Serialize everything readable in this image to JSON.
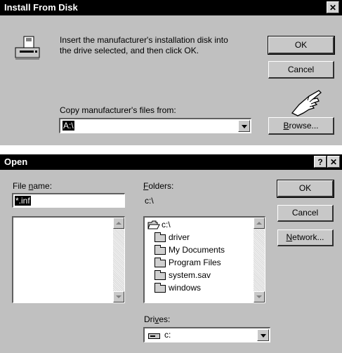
{
  "install_dialog": {
    "title": "Install From Disk",
    "close_glyph": "✕",
    "message_line1": "Insert the manufacturer's installation disk into",
    "message_line2": "the drive selected, and then click OK.",
    "ok_label": "OK",
    "cancel_label": "Cancel",
    "copy_label": "Copy manufacturer's files from:",
    "copy_value": "A:\\",
    "browse_label": "Browse...",
    "browse_mnemonic": "B",
    "browse_rest": "rowse..."
  },
  "open_dialog": {
    "title": "Open",
    "help_glyph": "?",
    "close_glyph": "✕",
    "file_name_label_pre": "File ",
    "file_name_mnemonic": "n",
    "file_name_label_post": "ame:",
    "file_name_value": "*.inf",
    "folders_label_mnemonic": "F",
    "folders_label_rest": "olders:",
    "current_path": "c:\\",
    "folders": [
      "c:\\",
      "driver",
      "My Documents",
      "Program Files",
      "system.sav",
      "windows"
    ],
    "drives_label_pre": "Dri",
    "drives_mnemonic": "v",
    "drives_label_post": "es:",
    "drive_value": "c:",
    "ok_label": "OK",
    "cancel_label": "Cancel",
    "network_mnemonic": "N",
    "network_rest": "etwork..."
  },
  "colors": {
    "titlebar": "#000000",
    "face": "#c0c0c0",
    "selection": "#000000"
  },
  "icons": [
    "floppy-drive-icon",
    "pointing-hand-icon",
    "folder-icon",
    "open-folder-icon",
    "drive-icon"
  ]
}
